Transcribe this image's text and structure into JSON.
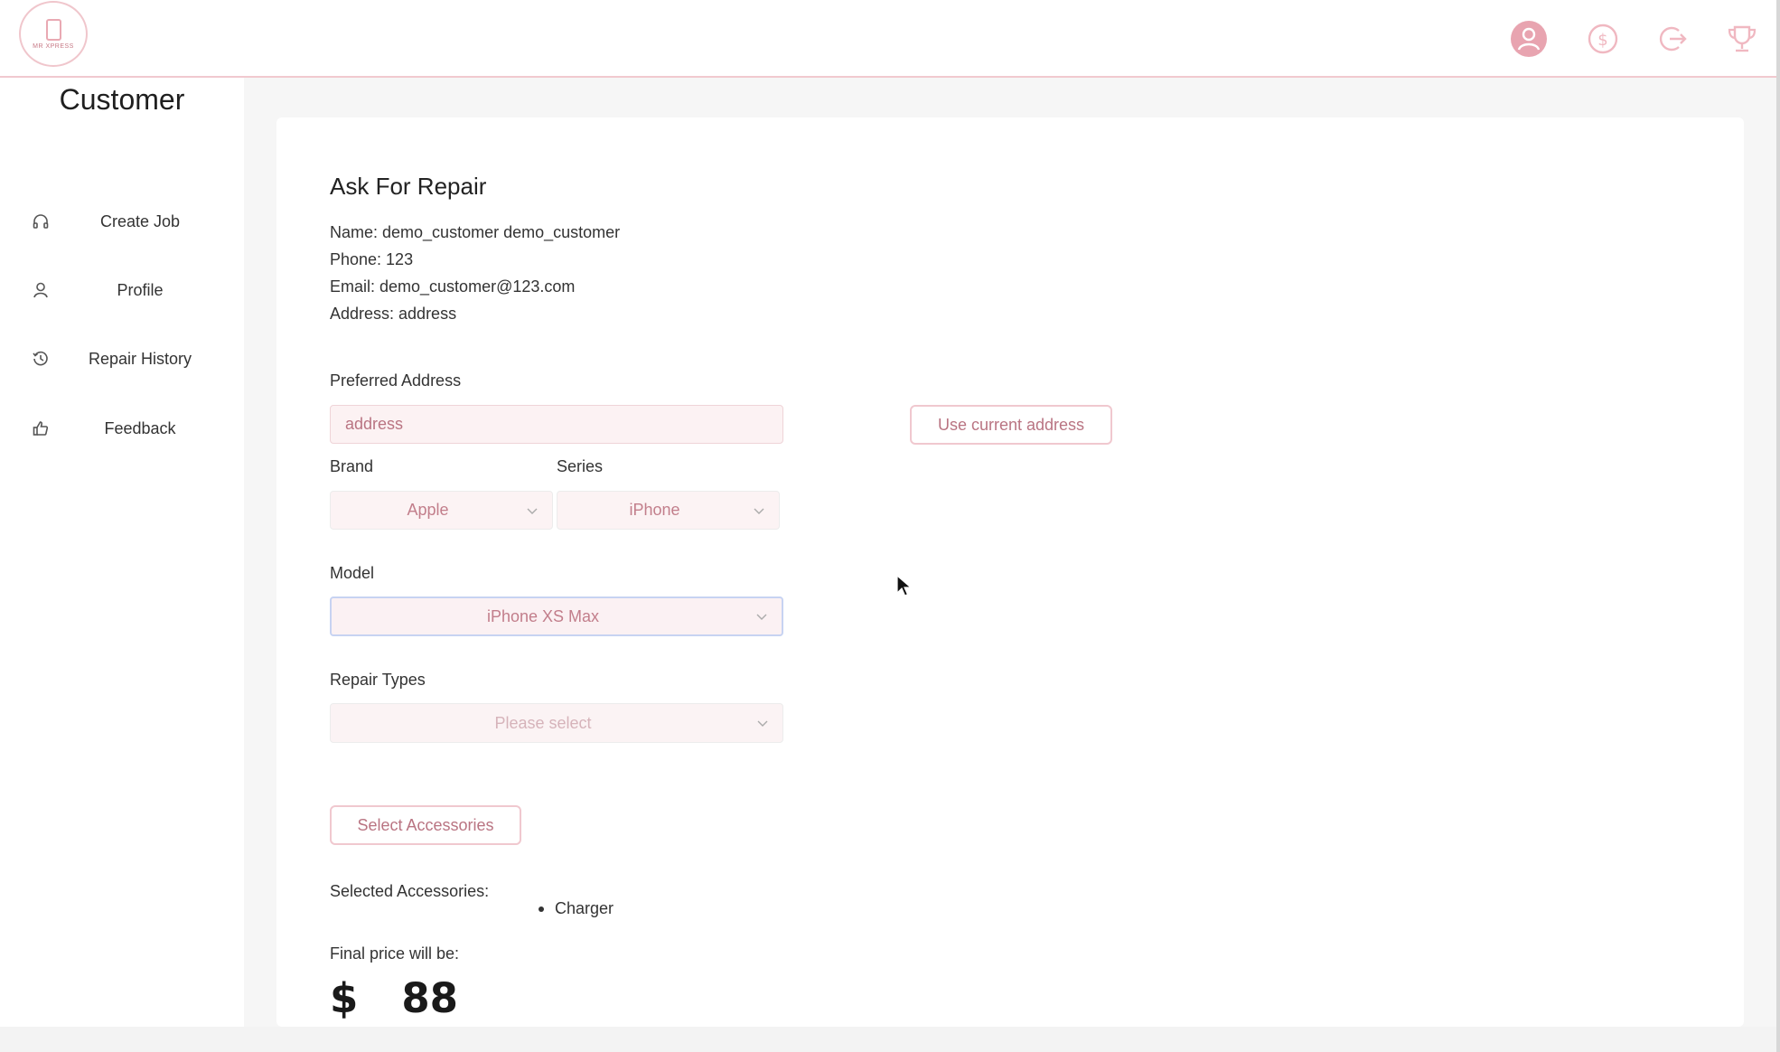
{
  "header": {
    "logo_text": "MR XPRESS",
    "icons": [
      "user-avatar-icon",
      "dollar-icon",
      "logout-icon",
      "trophy-icon"
    ],
    "accent_color": "#e8a4b0"
  },
  "sidebar": {
    "title": "Customer",
    "items": [
      {
        "label": "Create Job",
        "icon": "headphones-icon"
      },
      {
        "label": "Profile",
        "icon": "user-icon"
      },
      {
        "label": "Repair History",
        "icon": "history-icon"
      },
      {
        "label": "Feedback",
        "icon": "thumbs-up-icon"
      }
    ]
  },
  "main": {
    "title": "Ask For Repair",
    "customer": {
      "name": "Name: demo_customer demo_customer",
      "phone": "Phone: 123",
      "email": "Email: demo_customer@123.com",
      "address": "Address: address"
    },
    "preferred_address": {
      "label": "Preferred Address",
      "value": "address",
      "use_current_label": "Use current address"
    },
    "brand": {
      "label": "Brand",
      "value": "Apple"
    },
    "series": {
      "label": "Series",
      "value": "iPhone"
    },
    "model": {
      "label": "Model",
      "value": "iPhone XS Max"
    },
    "repair_types": {
      "label": "Repair Types",
      "placeholder": "Please select"
    },
    "select_accessories_label": "Select Accessories",
    "selected_accessories": {
      "label": "Selected Accessories:",
      "items": [
        "Charger"
      ]
    },
    "final_price": {
      "label": "Final price will be:",
      "currency": "$",
      "amount": "88"
    }
  }
}
